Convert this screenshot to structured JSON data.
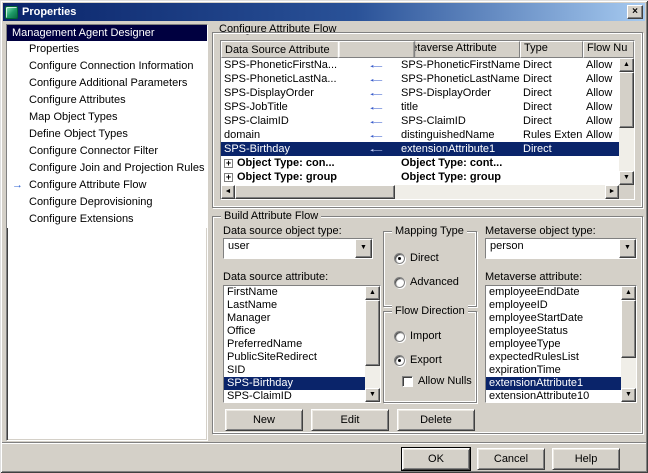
{
  "window": {
    "title": "Properties"
  },
  "colors": {
    "dialog_bg": "#d4d0c8",
    "titlebar_start": "#0a246a",
    "titlebar_end": "#a6caf0",
    "selection": "#0a246a",
    "sidebar_header_bg": "#000040",
    "flow_arrow_blue": "#2a50c8"
  },
  "icons": {
    "close": "×",
    "dropdown": "▼",
    "scroll_up": "▲",
    "scroll_down": "▼",
    "scroll_left": "◄",
    "scroll_right": "►"
  },
  "sidebar": {
    "header": "Management Agent Designer",
    "items": [
      {
        "label": "Properties",
        "arrow": "",
        "selected": false
      },
      {
        "label": "Configure Connection Information",
        "arrow": "",
        "selected": false
      },
      {
        "label": "Configure Additional Parameters",
        "arrow": "",
        "selected": false
      },
      {
        "label": "Configure Attributes",
        "arrow": "",
        "selected": false
      },
      {
        "label": "Map Object Types",
        "arrow": "",
        "selected": false
      },
      {
        "label": "Define Object Types",
        "arrow": "",
        "selected": false
      },
      {
        "label": "Configure Connector Filter",
        "arrow": "",
        "selected": false
      },
      {
        "label": "Configure Join and Projection Rules",
        "arrow": "",
        "selected": false
      },
      {
        "label": "Configure Attribute Flow",
        "arrow": "→",
        "selected": true
      },
      {
        "label": "Configure Deprovisioning",
        "arrow": "",
        "selected": false
      },
      {
        "label": "Configure Extensions",
        "arrow": "",
        "selected": false
      }
    ]
  },
  "main": {
    "title": "Configure Attribute Flow",
    "flow_table": {
      "columns": [
        "Data Source Attribute",
        "Metaverse Attribute",
        "Type",
        "Flow Nu"
      ],
      "rows": [
        {
          "expander": "",
          "ds": "SPS-PhoneticFirstNa...",
          "arrow": "←",
          "mv": "SPS-PhoneticFirstName",
          "type": "Direct",
          "nulls": "Allow",
          "selected": false,
          "bold": false
        },
        {
          "expander": "",
          "ds": "SPS-PhoneticLastNa...",
          "arrow": "←",
          "mv": "SPS-PhoneticLastName",
          "type": "Direct",
          "nulls": "Allow",
          "selected": false,
          "bold": false
        },
        {
          "expander": "",
          "ds": "SPS-DisplayOrder",
          "arrow": "←",
          "mv": "SPS-DisplayOrder",
          "type": "Direct",
          "nulls": "Allow",
          "selected": false,
          "bold": false
        },
        {
          "expander": "",
          "ds": "SPS-JobTitle",
          "arrow": "←",
          "mv": "title",
          "type": "Direct",
          "nulls": "Allow",
          "selected": false,
          "bold": false
        },
        {
          "expander": "",
          "ds": "SPS-ClaimID",
          "arrow": "←",
          "mv": "SPS-ClaimID",
          "type": "Direct",
          "nulls": "Allow",
          "selected": false,
          "bold": false
        },
        {
          "expander": "",
          "ds": "domain",
          "arrow": "←",
          "mv": "distinguishedName",
          "type": "Rules Exten...",
          "nulls": "Allow",
          "selected": false,
          "bold": false
        },
        {
          "expander": "",
          "ds": "SPS-Birthday",
          "arrow": "←",
          "mv": "extensionAttribute1",
          "type": "Direct",
          "nulls": "",
          "selected": true,
          "bold": false
        },
        {
          "expander": "+",
          "ds": "Object Type: con...",
          "arrow": "",
          "mv": "Object Type: cont...",
          "type": "",
          "nulls": "",
          "selected": false,
          "bold": true
        },
        {
          "expander": "+",
          "ds": "Object Type: group",
          "arrow": "",
          "mv": "Object Type: group",
          "type": "",
          "nulls": "",
          "selected": false,
          "bold": true
        }
      ]
    },
    "build": {
      "title": "Build Attribute Flow",
      "ds_object_type_label": "Data source object type:",
      "ds_object_type_value": "user",
      "mv_object_type_label": "Metaverse object type:",
      "mv_object_type_value": "person",
      "mapping_type": {
        "title": "Mapping Type",
        "options": [
          {
            "label": "Direct",
            "checked": true
          },
          {
            "label": "Advanced",
            "checked": false
          }
        ]
      },
      "flow_direction": {
        "title": "Flow Direction",
        "options": [
          {
            "label": "Import",
            "checked": false
          },
          {
            "label": "Export",
            "checked": true
          }
        ],
        "allow_nulls_label": "Allow Nulls",
        "allow_nulls_checked": false
      },
      "ds_attribute_label": "Data source attribute:",
      "ds_attributes": [
        {
          "label": "FirstName",
          "selected": false
        },
        {
          "label": "LastName",
          "selected": false
        },
        {
          "label": "Manager",
          "selected": false
        },
        {
          "label": "Office",
          "selected": false
        },
        {
          "label": "PreferredName",
          "selected": false
        },
        {
          "label": "PublicSiteRedirect",
          "selected": false
        },
        {
          "label": "SID",
          "selected": false
        },
        {
          "label": "SPS-Birthday",
          "selected": true
        },
        {
          "label": "SPS-ClaimID",
          "selected": false
        }
      ],
      "mv_attribute_label": "Metaverse attribute:",
      "mv_attributes": [
        {
          "label": "employeeEndDate",
          "selected": false
        },
        {
          "label": "employeeID",
          "selected": false
        },
        {
          "label": "employeeStartDate",
          "selected": false
        },
        {
          "label": "employeeStatus",
          "selected": false
        },
        {
          "label": "employeeType",
          "selected": false
        },
        {
          "label": "expectedRulesList",
          "selected": false
        },
        {
          "label": "expirationTime",
          "selected": false
        },
        {
          "label": "extensionAttribute1",
          "selected": true
        },
        {
          "label": "extensionAttribute10",
          "selected": false
        }
      ],
      "new_label": "New",
      "edit_label": "Edit",
      "delete_label": "Delete"
    }
  },
  "footer": {
    "ok_label": "OK",
    "cancel_label": "Cancel",
    "help_label": "Help"
  }
}
